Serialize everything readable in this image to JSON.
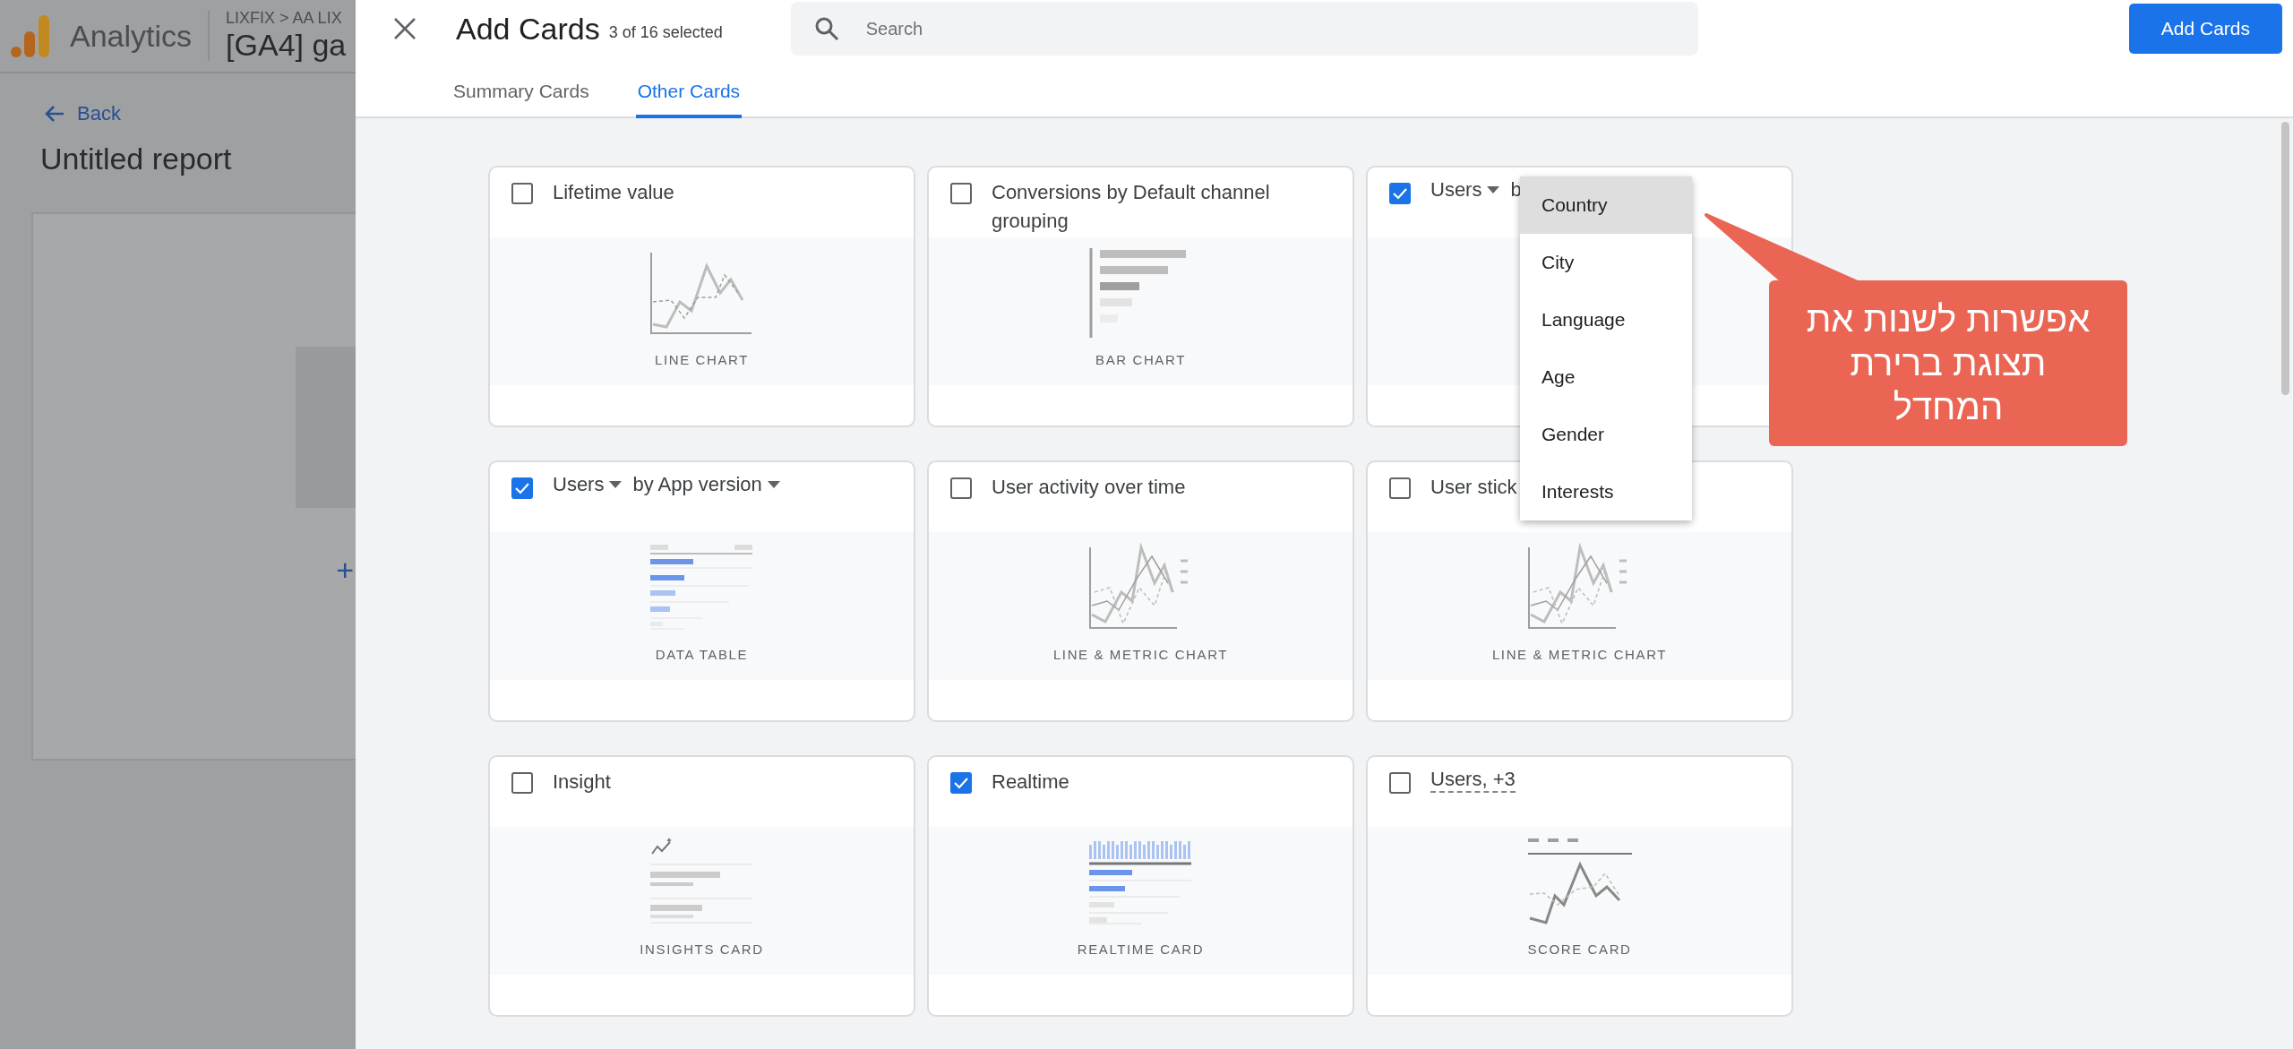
{
  "background_page": {
    "app_name": "Analytics",
    "breadcrumb": "LIXFIX > AA LIX",
    "property": "[GA4] ga",
    "back": "Back",
    "report_title": "Untitled report",
    "add_symbol": "+"
  },
  "dialog": {
    "title": "Add Cards",
    "selection_count": "3 of 16 selected",
    "search": {
      "placeholder": "Search"
    },
    "primary_button": "Add Cards",
    "tabs": [
      {
        "label": "Summary Cards",
        "selected": false
      },
      {
        "label": "Other Cards",
        "selected": true
      }
    ]
  },
  "cards": [
    {
      "kind": "plain",
      "title": "Lifetime value",
      "checked": false,
      "preview": {
        "kind": "line",
        "label": "LINE CHART"
      }
    },
    {
      "kind": "plain",
      "title": "Conversions by Default channel grouping",
      "checked": false,
      "preview": {
        "kind": "bar",
        "label": "BAR CHART"
      }
    },
    {
      "kind": "dimension_open",
      "metric": "Users",
      "dimension": "b",
      "checked": true,
      "preview": {
        "kind": "blank"
      }
    },
    {
      "kind": "dimension",
      "metric": "Users",
      "dimension": "by App version",
      "checked": true,
      "preview": {
        "kind": "table",
        "label": "DATA TABLE"
      }
    },
    {
      "kind": "plain",
      "title": "User activity over time",
      "checked": false,
      "preview": {
        "kind": "line_metric",
        "label": "LINE & METRIC CHART"
      }
    },
    {
      "kind": "plain",
      "title": "User stick",
      "checked": false,
      "preview": {
        "kind": "line_metric",
        "label": "LINE & METRIC CHART"
      }
    },
    {
      "kind": "plain",
      "title": "Insight",
      "checked": false,
      "preview": {
        "kind": "insights",
        "label": "INSIGHTS CARD"
      }
    },
    {
      "kind": "plain",
      "title": "Realtime",
      "checked": true,
      "preview": {
        "kind": "realtime",
        "label": "REALTIME CARD"
      }
    },
    {
      "kind": "multi",
      "title": "Users, +3",
      "checked": false,
      "preview": {
        "kind": "score",
        "label": "SCORE CARD"
      }
    }
  ],
  "dimension_menu": {
    "items": [
      {
        "label": "Country",
        "selected": true
      },
      {
        "label": "City",
        "selected": false
      },
      {
        "label": "Language",
        "selected": false
      },
      {
        "label": "Age",
        "selected": false
      },
      {
        "label": "Gender",
        "selected": false
      },
      {
        "label": "Interests",
        "selected": false
      }
    ]
  },
  "callout": {
    "lines": [
      "אפשרות לשנות את",
      "תצוגת ברירת",
      "המחדל"
    ]
  }
}
